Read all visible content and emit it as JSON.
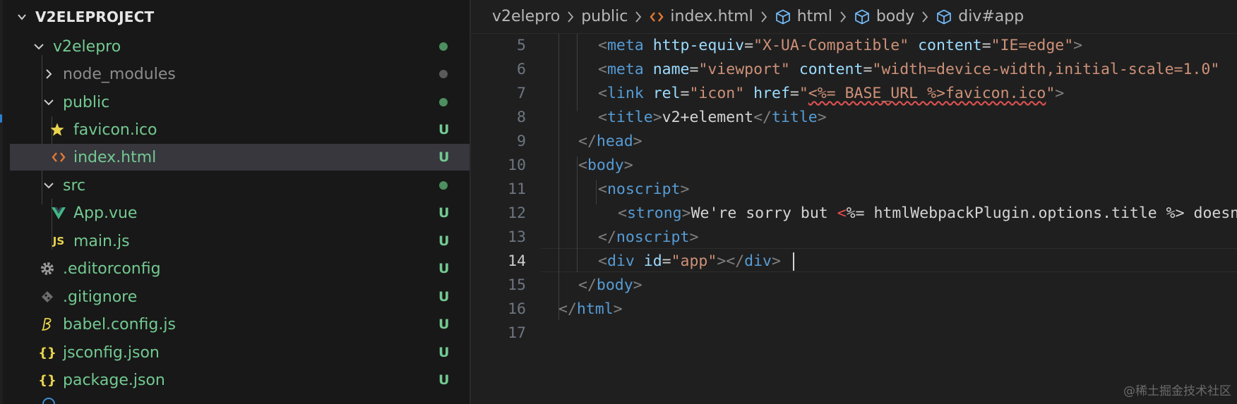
{
  "explorer": {
    "title": "V2ELEPROJECT",
    "items": [
      {
        "label": "v2elepro",
        "status": "dot"
      },
      {
        "label": "node_modules",
        "status": "dot"
      },
      {
        "label": "public",
        "status": "dot"
      },
      {
        "label": "favicon.ico",
        "status": "U"
      },
      {
        "label": "index.html",
        "status": "U"
      },
      {
        "label": "src",
        "status": "dot"
      },
      {
        "label": "App.vue",
        "status": "U"
      },
      {
        "label": "main.js",
        "status": "U"
      },
      {
        "label": ".editorconfig",
        "status": "U"
      },
      {
        "label": ".gitignore",
        "status": "U"
      },
      {
        "label": "babel.config.js",
        "status": "U"
      },
      {
        "label": "jsconfig.json",
        "status": "U"
      },
      {
        "label": "package.json",
        "status": "U"
      }
    ],
    "js_icon_text": "JS",
    "json_icon_text": "{}"
  },
  "breadcrumb": [
    "v2elepro",
    "public",
    "index.html",
    "html",
    "body",
    "div#app"
  ],
  "editor": {
    "active_line": "14",
    "lines": [
      {
        "num": "5"
      },
      {
        "num": "6"
      },
      {
        "num": "7"
      },
      {
        "num": "8"
      },
      {
        "num": "9"
      },
      {
        "num": "10"
      },
      {
        "num": "11"
      },
      {
        "num": "12"
      },
      {
        "num": "13"
      },
      {
        "num": "14"
      },
      {
        "num": "15"
      },
      {
        "num": "16"
      },
      {
        "num": "17"
      }
    ],
    "tokens": {
      "meta": "meta",
      "http_equiv": "http-equiv",
      "xua": "\"X-UA-Compatible\"",
      "content": "content",
      "ie_edge": "\"IE=edge\"",
      "name": "name",
      "viewport": "\"viewport\"",
      "viewport_content": "\"width=device-width,initial-scale=1.0\"",
      "link": "link",
      "rel": "rel",
      "icon": "\"icon\"",
      "href": "href",
      "href_q1": "\"",
      "href_tpl": "<%= BASE_URL %>favicon.ico",
      "href_q2": "\"",
      "title": "title",
      "title_text": "v2+element",
      "head": "head",
      "body": "body",
      "noscript": "noscript",
      "strong": "strong",
      "strong_text": "We're sorry but ",
      "strong_err": "<",
      "strong_rest": "%= htmlWebpackPlugin.options.title %> doesn't work properly without JavaScript enabled.",
      "div": "div",
      "id": "id",
      "app": "\"app\"",
      "html": "html"
    }
  },
  "watermark": "@稀土掘金技术社区",
  "colors": {
    "accent_green": "#73c991",
    "dot_green": "#4d8f5f",
    "dot_gray": "#5a5a5a",
    "html_orange": "#e37933",
    "star_yellow": "#e8d44d",
    "vue_green": "#41b883",
    "tag_blue": "#569cd6",
    "attr_lightblue": "#9cdcfe",
    "string_orange": "#ce9178"
  },
  "icons": {
    "folder_chevron": "chevron-icon",
    "favicon": "star-icon",
    "index_html": "html-icon",
    "app_vue": "vue-icon",
    "main_js": "js-icon",
    "editorconfig": "gear-icon",
    "gitignore": "git-icon",
    "babel": "babel-icon",
    "json": "json-icon",
    "breadcrumb_symbol": "cube-icon"
  }
}
